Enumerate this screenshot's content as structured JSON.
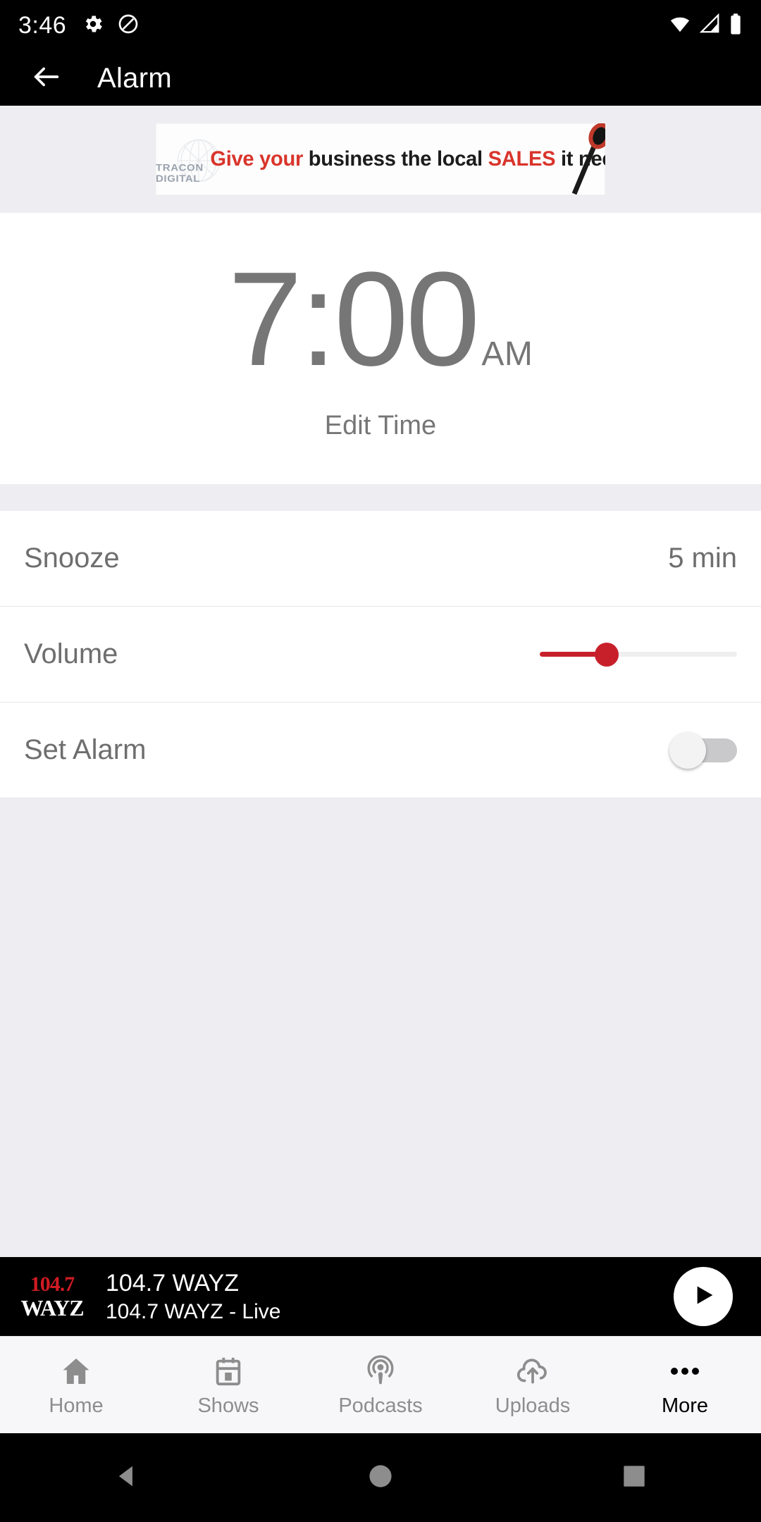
{
  "status_bar": {
    "time": "3:46",
    "icons": [
      "gear-icon",
      "do-not-disturb-icon",
      "wifi-icon",
      "cell-signal-icon",
      "battery-icon"
    ]
  },
  "app_bar": {
    "back_icon": "back-arrow-icon",
    "title": "Alarm"
  },
  "ad": {
    "advertiser": "TRACON DIGITAL",
    "copy_red_1": "Give your",
    "copy_black_1": " business the local ",
    "copy_red_2": "SALES",
    "copy_black_2": " it needs"
  },
  "clock": {
    "time": "7:00",
    "meridiem": "AM",
    "edit_label": "Edit Time",
    "text_color": "#767676"
  },
  "settings": {
    "snooze": {
      "label": "Snooze",
      "value": "5 min"
    },
    "volume": {
      "label": "Volume",
      "percent": 34,
      "accent_color": "#c8202b"
    },
    "set_alarm": {
      "label": "Set Alarm",
      "enabled": false
    }
  },
  "player": {
    "logo_top": "104.7",
    "logo_bottom": "WAYZ",
    "title": "104.7 WAYZ",
    "subtitle": "104.7 WAYZ - Live",
    "play_icon": "play-icon",
    "brand_color": "#cf1b23"
  },
  "bottom_nav": {
    "items": [
      {
        "label": "Home",
        "icon": "home-icon",
        "active": false
      },
      {
        "label": "Shows",
        "icon": "calendar-icon",
        "active": false
      },
      {
        "label": "Podcasts",
        "icon": "podcast-icon",
        "active": false
      },
      {
        "label": "Uploads",
        "icon": "cloud-upload-icon",
        "active": false
      },
      {
        "label": "More",
        "icon": "more-dots-icon",
        "active": true
      }
    ]
  },
  "system_nav": {
    "back": "triangle-back-icon",
    "home": "circle-home-icon",
    "recents": "square-recents-icon"
  }
}
